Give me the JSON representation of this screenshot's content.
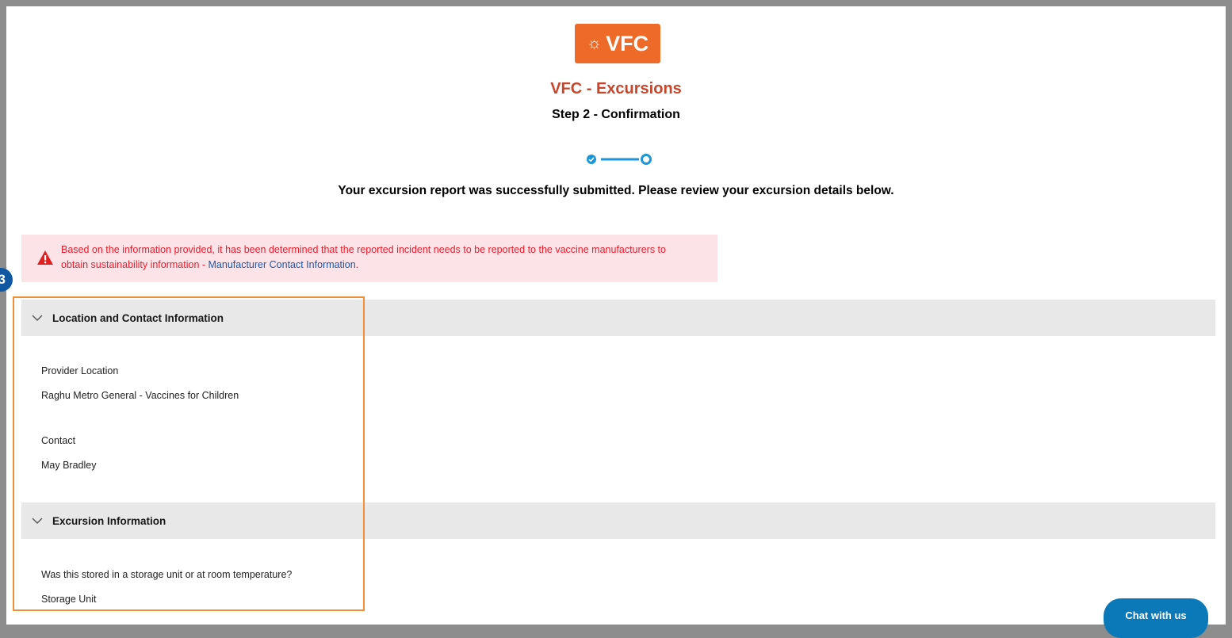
{
  "header": {
    "logo_text": "VFC",
    "app_title": "VFC - Excursions",
    "step_title": "Step 2 - Confirmation"
  },
  "progress": {
    "total_steps": 2,
    "current_step": 2,
    "completed_steps": 1
  },
  "success_message": "Your excursion report was successfully submitted. Please review your excursion details below.",
  "alert": {
    "text": "Based on the information provided, it has been determined that the reported incident needs to be reported to the vaccine manufacturers to obtain sustainability information - ",
    "link_text": "Manufacturer Contact Information",
    "trailing": "."
  },
  "callout_marker": "3",
  "sections": {
    "location": {
      "title": "Location and Contact Information",
      "provider_label": "Provider Location",
      "provider_value": "Raghu Metro General - Vaccines for Children",
      "contact_label": "Contact",
      "contact_value": "May Bradley"
    },
    "excursion": {
      "title": "Excursion Information",
      "storage_label": "Was this stored in a storage unit or at room temperature?",
      "storage_value": "Storage Unit"
    }
  },
  "chat_button_label": "Chat with us",
  "colors": {
    "brand_orange": "#ee6a28",
    "title_red": "#c8452a",
    "alert_bg": "#fce3e8",
    "alert_text": "#e5202e",
    "link_blue": "#1f57a8",
    "progress_blue": "#1b96d7",
    "highlight_orange": "#ef8f3a",
    "chat_blue": "#0b78b8"
  },
  "icons": {
    "logo": "sun-face-icon",
    "alert": "warning-triangle-icon",
    "section_toggle": "chevron-down-icon",
    "completed_step": "check-circle-icon",
    "current_step": "circle-outline-icon"
  }
}
